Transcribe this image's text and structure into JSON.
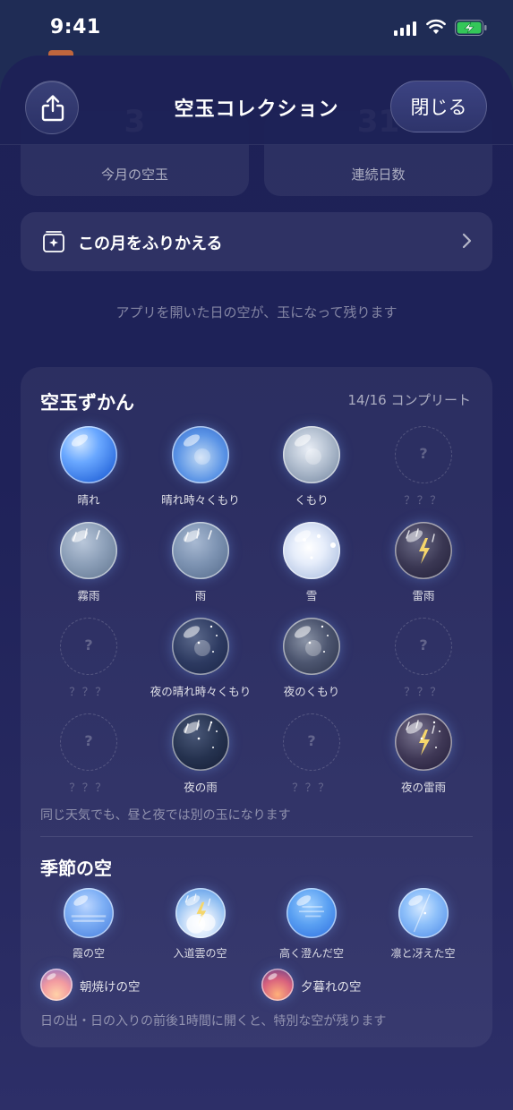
{
  "status_bar": {
    "time": "9:41"
  },
  "header": {
    "title": "空玉コレクション",
    "close_label": "閉じる"
  },
  "stats": [
    {
      "value": "3",
      "label": "今月の空玉"
    },
    {
      "value": "31",
      "label": "連続日数"
    }
  ],
  "review": {
    "label": "この月をふりかえる"
  },
  "note": "アプリを開いた日の空が、玉になって残ります",
  "dex": {
    "title": "空玉ずかん",
    "count": "14/16 コンプリート",
    "items": [
      {
        "name": "晴れ",
        "type": "sunny",
        "unlocked": true
      },
      {
        "name": "晴れ時々くもり",
        "type": "sunny-cloudy",
        "unlocked": true
      },
      {
        "name": "くもり",
        "type": "cloudy",
        "unlocked": true
      },
      {
        "name": "？？？",
        "type": "locked",
        "unlocked": false
      },
      {
        "name": "霧雨",
        "type": "drizzle",
        "unlocked": true
      },
      {
        "name": "雨",
        "type": "rain",
        "unlocked": true
      },
      {
        "name": "雪",
        "type": "snow",
        "unlocked": true
      },
      {
        "name": "雷雨",
        "type": "thunder",
        "unlocked": true
      },
      {
        "name": "？？？",
        "type": "locked",
        "unlocked": false
      },
      {
        "name": "夜の晴れ時々くもり",
        "type": "night-sunny-cloudy",
        "unlocked": true
      },
      {
        "name": "夜のくもり",
        "type": "night-cloudy",
        "unlocked": true
      },
      {
        "name": "？？？",
        "type": "locked",
        "unlocked": false
      },
      {
        "name": "？？？",
        "type": "locked",
        "unlocked": false
      },
      {
        "name": "夜の雨",
        "type": "night-rain",
        "unlocked": true
      },
      {
        "name": "？？？",
        "type": "locked",
        "unlocked": false
      },
      {
        "name": "夜の雷雨",
        "type": "night-thunder",
        "unlocked": true
      }
    ],
    "locked_mark": "?",
    "footnote": "同じ天気でも、昼と夜では別の玉になります"
  },
  "season": {
    "title": "季節の空",
    "items": [
      {
        "name": "霞の空",
        "type": "haze"
      },
      {
        "name": "入道雲の空",
        "type": "thunderhead"
      },
      {
        "name": "高く澄んだ空",
        "type": "clear-high"
      },
      {
        "name": "凛と冴えた空",
        "type": "crisp"
      }
    ],
    "special": [
      {
        "name": "朝焼けの空",
        "type": "dawn"
      },
      {
        "name": "夕暮れの空",
        "type": "dusk"
      }
    ],
    "footnote": "日の出・日の入りの前後1時間に開くと、特別な空が残ります"
  }
}
